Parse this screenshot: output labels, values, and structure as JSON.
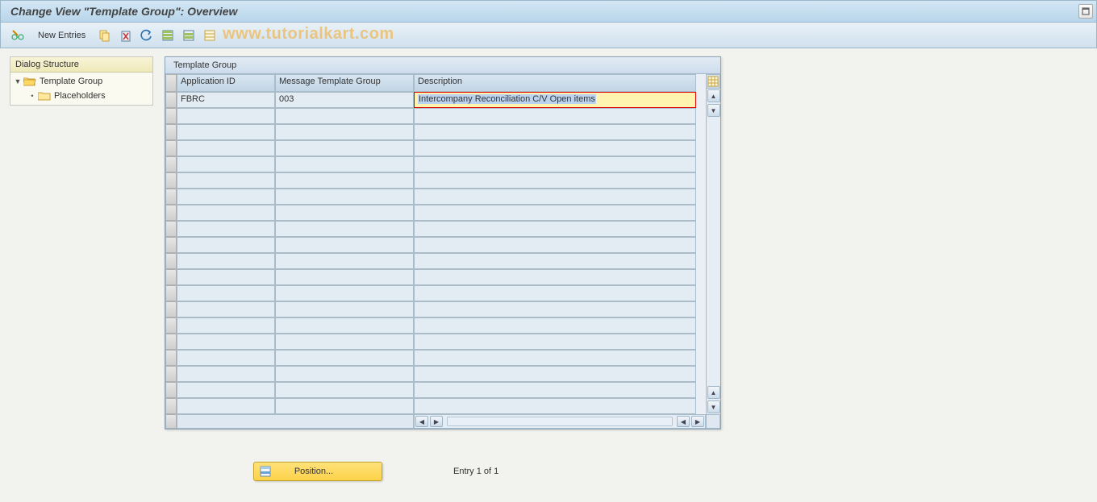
{
  "title": "Change View \"Template Group\": Overview",
  "toolbar": {
    "new_entries_label": "New Entries"
  },
  "watermark": "www.tutorialkart.com",
  "sidebar": {
    "header": "Dialog Structure",
    "items": [
      {
        "label": "Template Group",
        "open": true,
        "selected": true
      },
      {
        "label": "Placeholders",
        "open": false,
        "selected": false
      }
    ]
  },
  "panel": {
    "title": "Template Group",
    "columns": {
      "app_id": "Application ID",
      "msg_tmpl_group": "Message Template Group",
      "description": "Description"
    },
    "rows": [
      {
        "app_id": "FBRC",
        "msg_tmpl_group": "003",
        "description": "Intercompany Reconciliation C/V Open items"
      }
    ],
    "empty_row_count": 19
  },
  "footer": {
    "position_label": "Position...",
    "entry_text": "Entry 1 of 1"
  }
}
